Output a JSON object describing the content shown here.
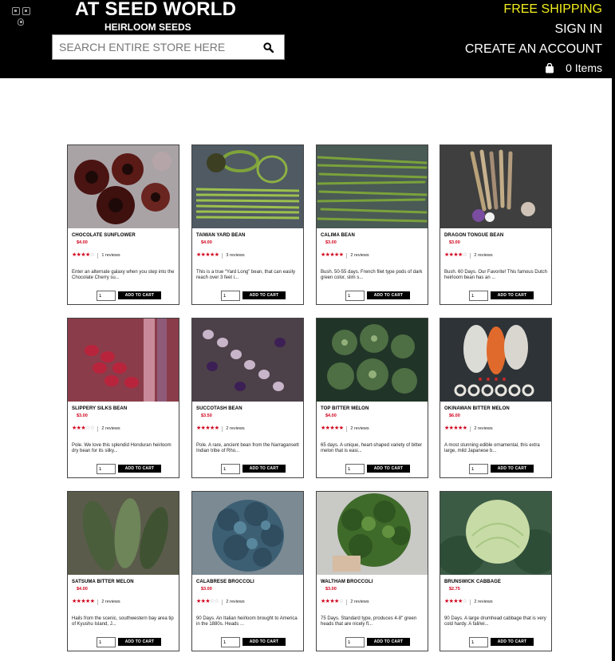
{
  "header": {
    "brand_name": "AT SEED WORLD",
    "brand_sub": "HEIRLOOM SEEDS",
    "search_placeholder": "SEARCH ENTIRE STORE HERE",
    "free_shipping": "FREE SHIPPING",
    "sign_in": "SIGN IN",
    "create_account": "CREATE AN ACCOUNT",
    "cart_count": "0 Items",
    "free_shipping_color": "#f2ee1e"
  },
  "product_actions": {
    "qty_default": "1",
    "add_to_cart": "ADD TO CART"
  },
  "products": [
    {
      "name": "CHOCOLATE SUNFLOWER",
      "price": "$4.00",
      "rating": 4,
      "reviews": "1 reviews",
      "desc": "Enter an alternate galaxy when you step into the Chocolate Cherry su..."
    },
    {
      "name": "TAIWAN YARD BEAN",
      "price": "$4.00",
      "rating": 4.5,
      "reviews": "3 reviews",
      "desc": "This is a true “Yard Long” bean, that can easily reach over 3 feet i..."
    },
    {
      "name": "CALIMA BEAN",
      "price": "$3.00",
      "rating": 5,
      "reviews": "2 reviews",
      "desc": "Bush. 50-55 days. French filet type pods of dark green color, slim s..."
    },
    {
      "name": "DRAGON TONGUE BEAN",
      "price": "$3.00",
      "rating": 4,
      "reviews": "2 reviews",
      "desc": "Bush. 60 Days. Our Favorite! This famous Dutch heirloom bean has an ..."
    },
    {
      "name": "SLIPPERY SILKS BEAN",
      "price": "$3.00",
      "rating": 2.5,
      "reviews": "2 reviews",
      "desc": "Pole. We love this splendid Honduran heirloom dry bean for its silky..."
    },
    {
      "name": "SUCCOTASH BEAN",
      "price": "$3.50",
      "rating": 4.5,
      "reviews": "2 reviews",
      "desc": "Pole. A rare, ancient bean from the Narragansett Indian tribe of Rho..."
    },
    {
      "name": "TOP BITTER MELON",
      "price": "$4.00",
      "rating": 4.5,
      "reviews": "2 reviews",
      "desc": "65 days. A unique, heart-shaped variety of bitter melon that is easi..."
    },
    {
      "name": "OKINAWAN BITTER MELON",
      "price": "$6.00",
      "rating": 4.5,
      "reviews": "2 reviews",
      "desc": "A most stunning edible ornamental, this extra large, mild Japanese b..."
    },
    {
      "name": "SATSUMA BITTER MELON",
      "price": "$4.00",
      "rating": 5,
      "reviews": "2 reviews",
      "desc": "Hails from the scenic, southwestern bay area tip of Kyushu Island, J..."
    },
    {
      "name": "CALABRESE BROCCOLI",
      "price": "$3.00",
      "rating": 2.5,
      "reviews": "2 reviews",
      "desc": "90 Days. An Italian heirloom brought to America in the 1880s. Heads ..."
    },
    {
      "name": "WALTHAM BROCCOLI",
      "price": "$3.00",
      "rating": 4,
      "reviews": "2 reviews",
      "desc": "75 Days. Standard type, produces 4-8\" green heads that are nicely fl..."
    },
    {
      "name": "BRUNSWICK CABBAGE",
      "price": "$2.75",
      "rating": 4,
      "reviews": "2 reviews",
      "desc": "90 Days. A large drumhead cabbage that is very cold hardy. A fall/wi..."
    }
  ]
}
